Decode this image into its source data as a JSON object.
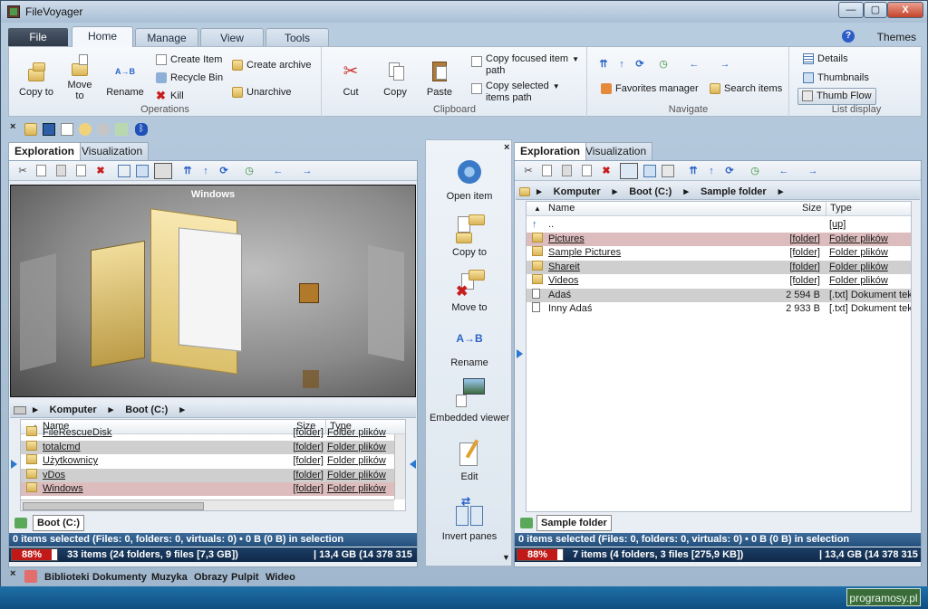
{
  "window": {
    "title": "FileVoyager",
    "minimize": "—",
    "maximize": "▢",
    "close": "X"
  },
  "menu": {
    "file": "File",
    "tabs": [
      "Home",
      "Manage",
      "View",
      "Tools"
    ],
    "help": "?",
    "themes": "Themes"
  },
  "ribbon": {
    "operations": {
      "label": "Operations",
      "copy_to": "Copy to",
      "move_to": "Move to",
      "rename": "Rename",
      "create_item": "Create Item",
      "recycle_bin": "Recycle Bin",
      "kill": "Kill",
      "create_archive": "Create archive",
      "unarchive": "Unarchive"
    },
    "clipboard": {
      "label": "Clipboard",
      "cut": "Cut",
      "copy": "Copy",
      "paste": "Paste",
      "copy_focused_1": "Copy focused item",
      "copy_focused_2": "path",
      "copy_selected_1": "Copy selected",
      "copy_selected_2": "items path"
    },
    "navigate": {
      "label": "Navigate",
      "favorites_manager": "Favorites manager",
      "search_items": "Search items"
    },
    "list_display": {
      "label": "List display",
      "details": "Details",
      "thumbnails": "Thumbnails",
      "thumb_flow": "Thumb Flow"
    }
  },
  "left_pane": {
    "tabs": [
      "Exploration",
      "Visualization"
    ],
    "viewer_title": "Windows",
    "breadcrumb": [
      "Komputer",
      "Boot (C:)"
    ],
    "columns": {
      "name": "Name",
      "size": "Size",
      "type": "Type"
    },
    "rows": [
      {
        "name": "FileRescueDisk",
        "size": "[folder]",
        "type": "Folder plików",
        "style": "clip"
      },
      {
        "name": "totalcmd",
        "size": "[folder]",
        "type": "Folder plików",
        "style": "gray"
      },
      {
        "name": "Użytkownicy",
        "size": "[folder]",
        "type": "Folder plików",
        "style": "plain"
      },
      {
        "name": "vDos",
        "size": "[folder]",
        "type": "Folder plików",
        "style": "gray"
      },
      {
        "name": "Windows",
        "size": "[folder]",
        "type": "Folder plików",
        "style": "pink"
      }
    ],
    "bottom_tab": "Boot (C:)",
    "status": "0 items selected (Files: 0, folders: 0, virtuals: 0) • 0 B (0 B) in selection",
    "disk_pct_label": "88%",
    "disk_pct": 0.88,
    "items_summary": "33 items (24 folders, 9 files [7,3 GB])",
    "disk_free": "| 13,4 GB (14 378 315"
  },
  "center": {
    "buttons": [
      "Open item",
      "Copy to",
      "Move to",
      "Rename",
      "Embedded viewer",
      "Edit",
      "Invert panes"
    ]
  },
  "right_pane": {
    "tabs": [
      "Exploration",
      "Visualization"
    ],
    "breadcrumb": [
      "Komputer",
      "Boot (C:)",
      "Sample folder"
    ],
    "columns": {
      "name": "Name",
      "size": "Size",
      "type": "Type"
    },
    "rows": [
      {
        "name": "..",
        "size": "",
        "type": "[up]",
        "style": "plain",
        "kind": "up"
      },
      {
        "name": "Pictures",
        "size": "[folder]",
        "type": "Folder plików",
        "style": "pink",
        "kind": "folder"
      },
      {
        "name": "Sample Pictures",
        "size": "[folder]",
        "type": "Folder plików",
        "style": "plain",
        "kind": "folder"
      },
      {
        "name": "Shareit",
        "size": "[folder]",
        "type": "Folder plików",
        "style": "gray",
        "kind": "folder"
      },
      {
        "name": "Videos",
        "size": "[folder]",
        "type": "Folder plików",
        "style": "plain",
        "kind": "folder"
      },
      {
        "name": "Adaś",
        "size": "2 594 B",
        "type": "[.txt]  Dokument teks",
        "style": "gray",
        "kind": "file"
      },
      {
        "name": "Inny Adaś",
        "size": "2 933 B",
        "type": "[.txt]  Dokument teks",
        "style": "plain",
        "kind": "file"
      }
    ],
    "bottom_tab": "Sample folder",
    "status": "0 items selected (Files: 0, folders: 0, virtuals: 0) • 0 B (0 B) in selection",
    "disk_pct_label": "88%",
    "disk_pct": 0.88,
    "items_summary": "7 items (4 folders, 3 files [275,9 KB])",
    "disk_free": "| 13,4 GB (14 378 315"
  },
  "libraries": [
    "Biblioteki",
    "Dokumenty",
    "Muzyka",
    "Obrazy",
    "Pulpit",
    "Wideo"
  ],
  "watermark": "programosy.pl",
  "colors": {
    "accent": "#24507c",
    "selection_pink": "#dcbcbc",
    "selection_gray": "#cfcfcf",
    "disk_bar": "#c11818"
  }
}
